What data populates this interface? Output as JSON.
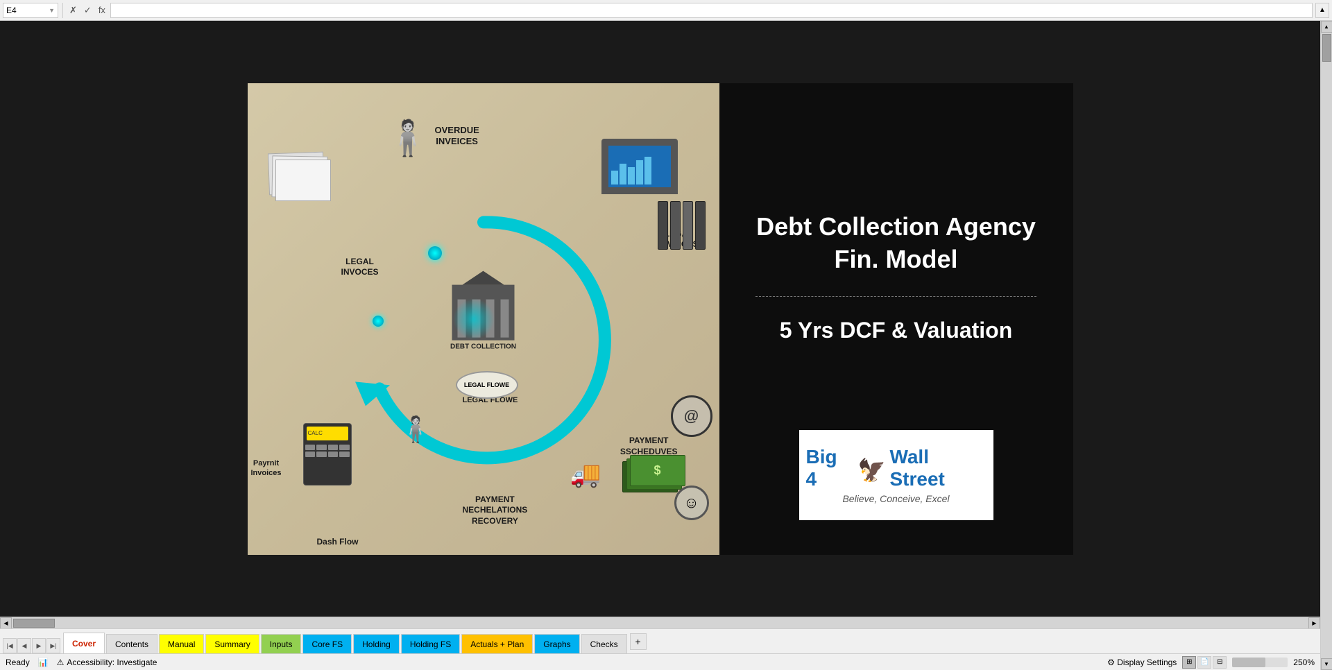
{
  "formula_bar": {
    "cell_ref": "E4",
    "formula_text": "",
    "cancel_label": "✗",
    "confirm_label": "✓",
    "function_label": "fx"
  },
  "slide": {
    "title": "Debt Collection Agency Fin. Model",
    "subtitle": "5 Yrs DCF & Valuation",
    "logo": {
      "big4": "Big 4",
      "wallstreet": "Wall Street",
      "tagline": "Believe, Conceive, Excel"
    },
    "illustration": {
      "labels": [
        {
          "id": "overdue-invoices",
          "text": "OVERDUE\nINVEICES"
        },
        {
          "id": "legal-invocces",
          "text": "LEGAL\nINVICCES"
        },
        {
          "id": "legal-invoces",
          "text": "LEGAL\nINVOCES"
        },
        {
          "id": "legal-flowe",
          "text": "LEGAL FLOWE"
        },
        {
          "id": "payment-scheduves",
          "text": "PAYMENT\nSSCHEDUVES"
        },
        {
          "id": "payment-negotiations",
          "text": "PAYMENT\nNECHELATIONS\nRECOVERY"
        },
        {
          "id": "cash-flow",
          "text": "Dash Flow"
        },
        {
          "id": "payment-invoices",
          "text": "Payrnit\nInvoices"
        },
        {
          "id": "debt-collection",
          "text": "DEBT\nCOLLECTION"
        }
      ]
    }
  },
  "tabs": [
    {
      "id": "cover",
      "label": "Cover",
      "style": "active"
    },
    {
      "id": "contents",
      "label": "Contents",
      "style": "default"
    },
    {
      "id": "manual",
      "label": "Manual",
      "style": "yellow"
    },
    {
      "id": "summary",
      "label": "Summary",
      "style": "yellow"
    },
    {
      "id": "inputs",
      "label": "Inputs",
      "style": "green"
    },
    {
      "id": "core-fs",
      "label": "Core FS",
      "style": "blue"
    },
    {
      "id": "holding",
      "label": "Holding",
      "style": "blue"
    },
    {
      "id": "holding-fs",
      "label": "Holding FS",
      "style": "blue"
    },
    {
      "id": "actuals-plan",
      "label": "Actuals + Plan",
      "style": "orange"
    },
    {
      "id": "graphs",
      "label": "Graphs",
      "style": "blue"
    },
    {
      "id": "checks",
      "label": "Checks",
      "style": "default"
    }
  ],
  "status_bar": {
    "ready": "Ready",
    "accessibility": "Accessibility: Investigate",
    "display_settings": "Display Settings",
    "zoom": "250%"
  }
}
